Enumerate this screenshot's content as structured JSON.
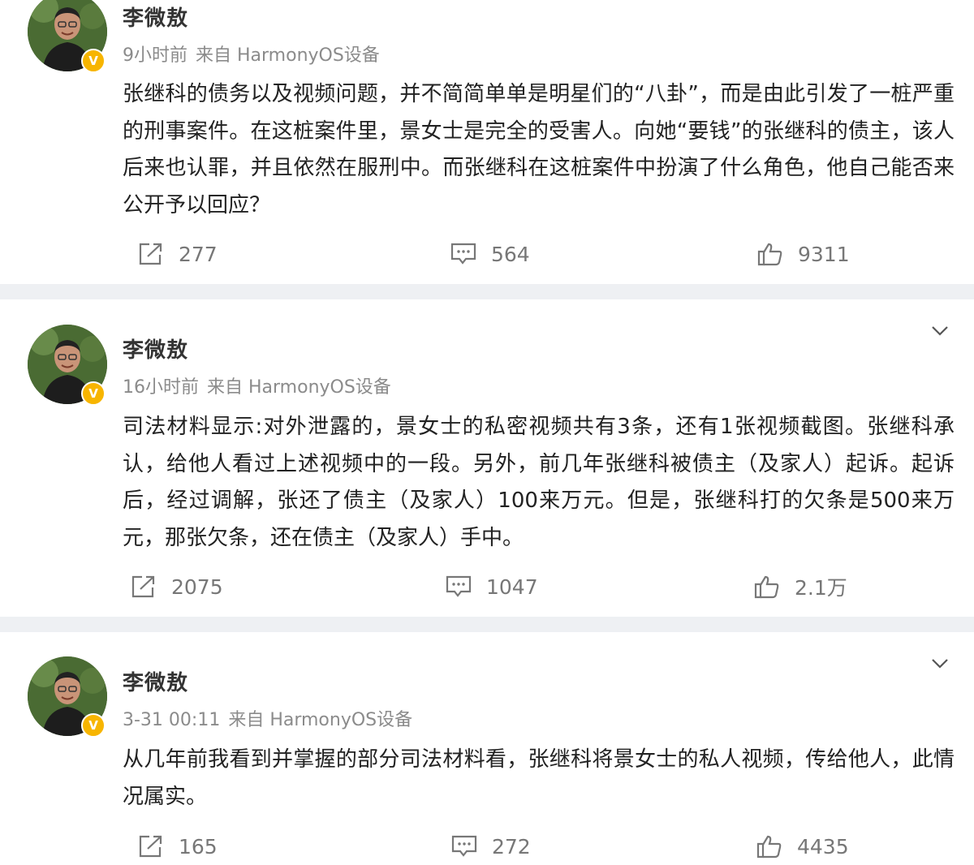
{
  "posts": [
    {
      "author": "李微敖",
      "time": "9小时前",
      "source": "来自 HarmonyOS设备",
      "text": "张继科的债务以及视频问题，并不简简单单是明星们的“八卦”，而是由此引发了一桩严重的刑事案件。在这桩案件里，景女士是完全的受害人。向她“要钱”的张继科的债主，该人后来也认罪，并且依然在服刑中。而张继科在这桩案件中扮演了什么角色，他自己能否来公开予以回应？",
      "repost_count": "277",
      "comment_count": "564",
      "like_count": "9311"
    },
    {
      "author": "李微敖",
      "time": "16小时前",
      "source": "来自 HarmonyOS设备",
      "text": "司法材料显示:对外泄露的，景女士的私密视频共有3条，还有1张视频截图。张继科承认，给他人看过上述视频中的一段。另外，前几年张继科被债主（及家人）起诉。起诉后，经过调解，张还了债主（及家人）100来万元。但是，张继科打的欠条是500来万元，那张欠条，还在债主（及家人）手中。",
      "repost_count": "2075",
      "comment_count": "1047",
      "like_count": "2.1万"
    },
    {
      "author": "李微敖",
      "time": "3-31 00:11",
      "source": "来自 HarmonyOS设备",
      "text": "从几年前我看到并掌握的部分司法材料看，张继科将景女士的私人视频，传给他人，此情况属实。",
      "repost_count": "165",
      "comment_count": "272",
      "like_count": "4435"
    }
  ],
  "icons": {
    "repost": "repost-icon",
    "comment": "comment-icon",
    "like": "thumbs-up-icon",
    "more": "chevron-down-icon",
    "verified": "verified-badge-icon"
  },
  "colors": {
    "verified_badge": "#f7b500",
    "separator": "#eef0f3",
    "meta_text": "#8b8b8b"
  }
}
